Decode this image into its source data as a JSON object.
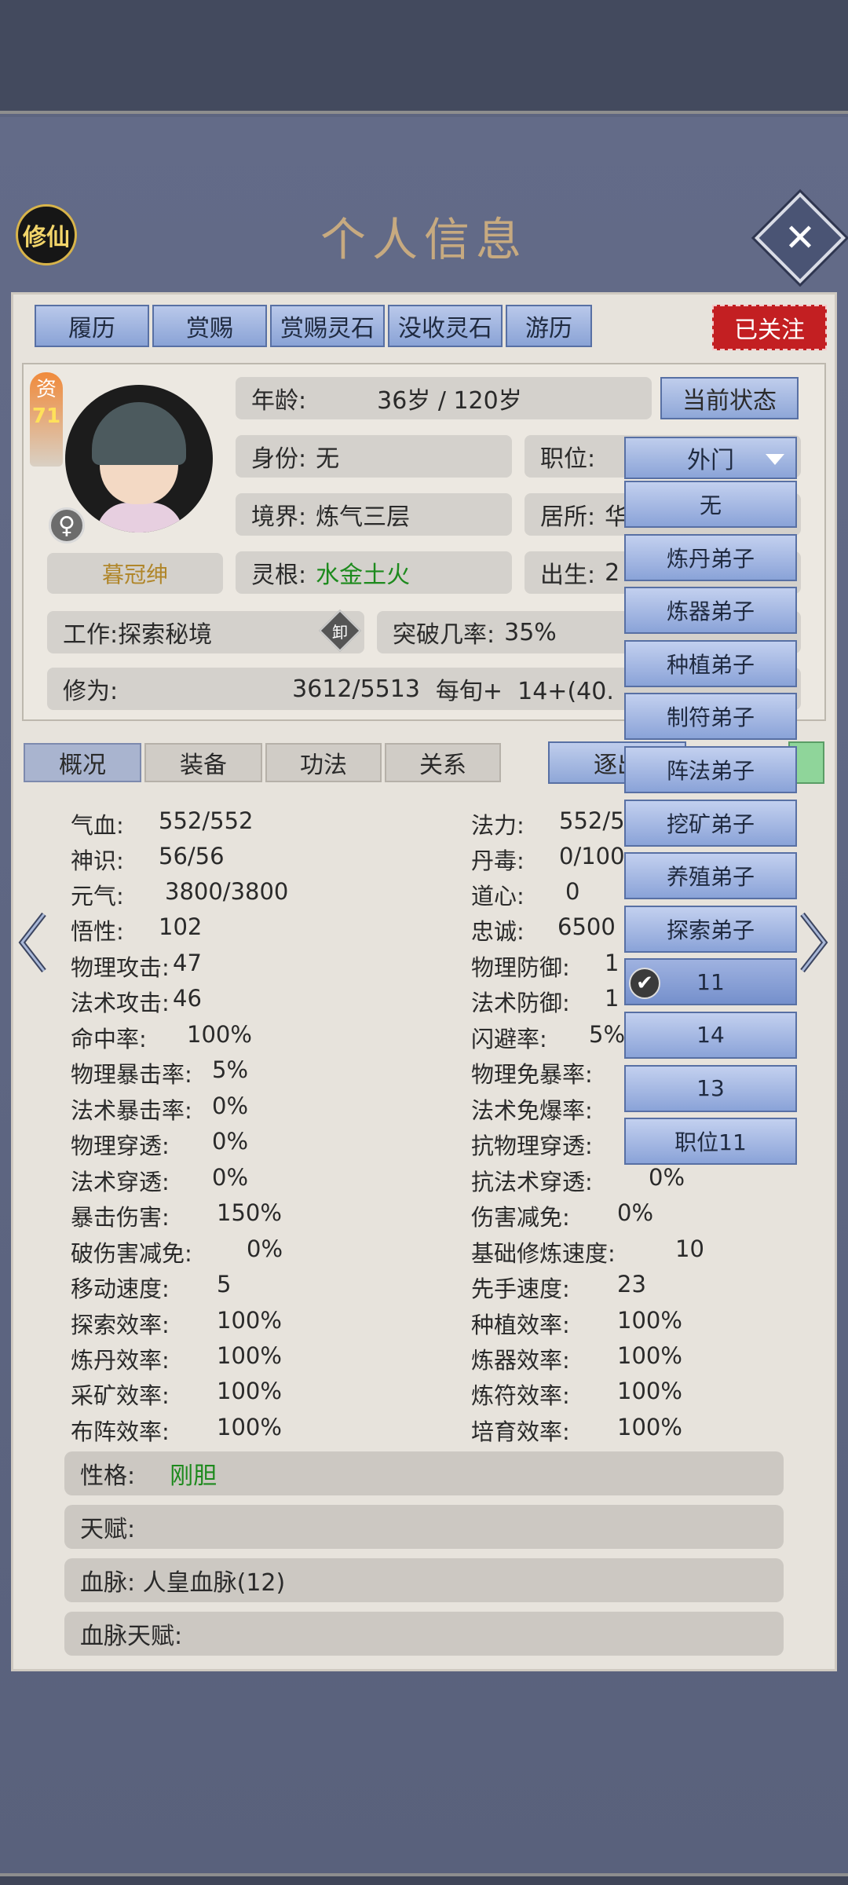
{
  "header": {
    "title": "个人信息",
    "logo_text": "修仙",
    "close_symbol": "✕"
  },
  "tabs": [
    "履历",
    "赏赐",
    "赏赐灵石",
    "没收灵石",
    "游历"
  ],
  "follow_badge": "已关注",
  "profile": {
    "aptitude_label": "资",
    "aptitude_value": "71",
    "gender_symbol": "♀",
    "name": "暮冠绅",
    "age_label": "年龄:",
    "age_value": "36岁 / 120岁",
    "current_state_button": "当前状态",
    "identity_label": "身份:",
    "identity_value": "无",
    "position_label": "职位:",
    "realm_label": "境界:",
    "realm_value": "炼气三层",
    "residence_label": "居所:",
    "residence_value": "华",
    "spirit_root_label": "灵根:",
    "spirit_root_value": "水金土火",
    "birth_label": "出生:",
    "birth_value": "2",
    "work_label": "工作:",
    "work_value": "探索秘境",
    "work_icon_text": "卸",
    "breakthrough_label": "突破几率:",
    "breakthrough_value": "35%",
    "cultivation_label": "修为:",
    "cultivation_value": "3612/5513",
    "cultivation_rate": "每旬+  14+(40.",
    "green_color": "#1d8a1d"
  },
  "sub_tabs": [
    "概况",
    "装备",
    "功法",
    "关系"
  ],
  "expel_button": "逐出",
  "stats_left": [
    {
      "label": "气血:",
      "value": "552/552"
    },
    {
      "label": "神识:",
      "value": "56/56"
    },
    {
      "label": "元气:",
      "value": "3800/3800"
    },
    {
      "label": "悟性:",
      "value": "102"
    },
    {
      "label": "物理攻击:",
      "value": "47"
    },
    {
      "label": "法术攻击:",
      "value": "46"
    },
    {
      "label": "命中率:",
      "value": "100%"
    },
    {
      "label": "物理暴击率:",
      "value": "5%"
    },
    {
      "label": "法术暴击率:",
      "value": "0%"
    },
    {
      "label": "物理穿透:",
      "value": "0%"
    },
    {
      "label": "法术穿透:",
      "value": "0%"
    },
    {
      "label": "暴击伤害:",
      "value": "150%"
    },
    {
      "label": "破伤害减免:",
      "value": "0%"
    },
    {
      "label": "移动速度:",
      "value": "5"
    },
    {
      "label": "探索效率:",
      "value": "100%"
    },
    {
      "label": "炼丹效率:",
      "value": "100%"
    },
    {
      "label": "采矿效率:",
      "value": "100%"
    },
    {
      "label": "布阵效率:",
      "value": "100%"
    }
  ],
  "stats_right": [
    {
      "label": "法力:",
      "value": "552/5"
    },
    {
      "label": "丹毒:",
      "value": "0/100"
    },
    {
      "label": "道心:",
      "value": "0"
    },
    {
      "label": "忠诚:",
      "value": "6500"
    },
    {
      "label": "物理防御:",
      "value": "1"
    },
    {
      "label": "法术防御:",
      "value": "1"
    },
    {
      "label": "闪避率:",
      "value": "5%"
    },
    {
      "label": "物理免暴率:",
      "value": ""
    },
    {
      "label": "法术免爆率:",
      "value": ""
    },
    {
      "label": "抗物理穿透:",
      "value": ""
    },
    {
      "label": "抗法术穿透:",
      "value": "0%"
    },
    {
      "label": "伤害减免:",
      "value": "0%"
    },
    {
      "label": "基础修炼速度:",
      "value": "10"
    },
    {
      "label": "先手速度:",
      "value": "23"
    },
    {
      "label": "种植效率:",
      "value": "100%"
    },
    {
      "label": "炼器效率:",
      "value": "100%"
    },
    {
      "label": "炼符效率:",
      "value": "100%"
    },
    {
      "label": "培育效率:",
      "value": "100%"
    }
  ],
  "bars": {
    "personality_label": "性格:",
    "personality_value": "刚胆",
    "talent_label": "天赋:",
    "bloodline_label": "血脉: 人皇血脉(12)",
    "bloodline_talent_label": "血脉天赋:"
  },
  "position_dropdown": {
    "selected": "外门",
    "options": [
      "无",
      "炼丹弟子",
      "炼器弟子",
      "种植弟子",
      "制符弟子",
      "阵法弟子",
      "挖矿弟子",
      "养殖弟子",
      "探索弟子",
      "11",
      "14",
      "13",
      "职位11"
    ],
    "checked_option": "11",
    "check_symbol": "✔"
  }
}
